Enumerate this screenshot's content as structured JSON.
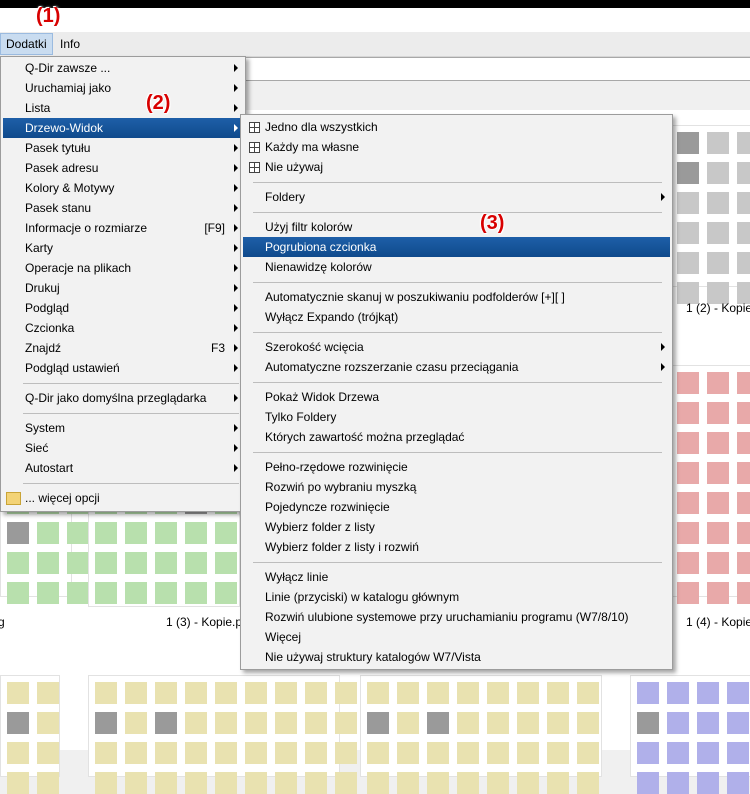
{
  "annotations": [
    "(1)",
    "(2)",
    "(3)"
  ],
  "menubar": {
    "items": [
      "Dodatki",
      "Info"
    ]
  },
  "main_menu": {
    "items": [
      {
        "label": "Q-Dir zawsze ...",
        "arrow": true
      },
      {
        "label": "Uruchamiaj jako",
        "arrow": true
      },
      {
        "label": "Lista",
        "arrow": true
      },
      {
        "label": "Drzewo-Widok",
        "arrow": true
      },
      {
        "label": "Pasek tytułu",
        "arrow": true
      },
      {
        "label": "Pasek adresu",
        "arrow": true
      },
      {
        "label": "Kolory & Motywy",
        "arrow": true
      },
      {
        "label": "Pasek stanu",
        "arrow": true
      },
      {
        "label": "Informacje o rozmiarze",
        "shortcut": "[F9]",
        "arrow": true
      },
      {
        "label": "Karty",
        "arrow": true
      },
      {
        "label": "Operacje na plikach",
        "arrow": true
      },
      {
        "label": "Drukuj",
        "arrow": true
      },
      {
        "label": "Podgląd",
        "arrow": true
      },
      {
        "label": "Czcionka",
        "arrow": true
      },
      {
        "label": "Znajdź",
        "shortcut": "F3",
        "arrow": true
      },
      {
        "label": "Podgląd ustawień",
        "arrow": true
      },
      {
        "label": "Q-Dir jako domyślna przeglądarka",
        "arrow": true
      },
      {
        "label": "System",
        "arrow": true
      },
      {
        "label": "Sieć",
        "arrow": true
      },
      {
        "label": "Autostart",
        "arrow": true
      },
      {
        "label": "... więcej opcji",
        "icon": "folder-icon"
      }
    ]
  },
  "sub_menu": {
    "items": [
      {
        "label": "Jedno dla wszystkich",
        "icon": "grid-icon"
      },
      {
        "label": "Każdy ma własne",
        "icon": "grid-icon"
      },
      {
        "label": "Nie używaj",
        "icon": "grid-icon"
      },
      {
        "label": "Foldery",
        "arrow": true
      },
      {
        "label": "Użyj filtr kolorów"
      },
      {
        "label": "Pogrubiona czcionka"
      },
      {
        "label": "Nienawidzę kolorów"
      },
      {
        "label": "Automatycznie skanuj w poszukiwaniu podfolderów [+][ ]"
      },
      {
        "label": "Wyłącz Expando (trójkąt)"
      },
      {
        "label": "Szerokość wcięcia",
        "arrow": true
      },
      {
        "label": "Automatyczne rozszerzanie czasu przeciągania",
        "arrow": true
      },
      {
        "label": "Pokaż Widok Drzewa"
      },
      {
        "label": "Tylko Foldery"
      },
      {
        "label": "Których zawartość można przeglądać"
      },
      {
        "label": "Pełno-rzędowe rozwinięcie"
      },
      {
        "label": "Rozwiń po wybraniu myszką"
      },
      {
        "label": "Pojedyncze rozwinięcie"
      },
      {
        "label": "Wybierz folder z listy"
      },
      {
        "label": "Wybierz folder z listy i rozwiń"
      },
      {
        "label": "Wyłącz linie"
      },
      {
        "label": "Linie (przyciski) w katalogu głównym"
      },
      {
        "label": "Rozwiń ulubione systemowe przy uruchamianiu programu (W7/8/10)"
      },
      {
        "label": "Więcej"
      },
      {
        "label": "Nie używaj struktury katalogów W7/Vista"
      }
    ]
  },
  "file_labels": [
    "1 (2) - Kopie",
    "1 (3) - Kopie.p",
    "1 (4) - Kopie",
    "g"
  ],
  "colors": {
    "highlight": "#1e5fa8",
    "annotation": "#d80000",
    "thumb_gray": "#c8c8c8",
    "thumb_red": "#e8a9a9",
    "thumb_green": "#b8e0ad",
    "thumb_yellow": "#e9e2b0",
    "thumb_blue": "#b0b0ea"
  }
}
